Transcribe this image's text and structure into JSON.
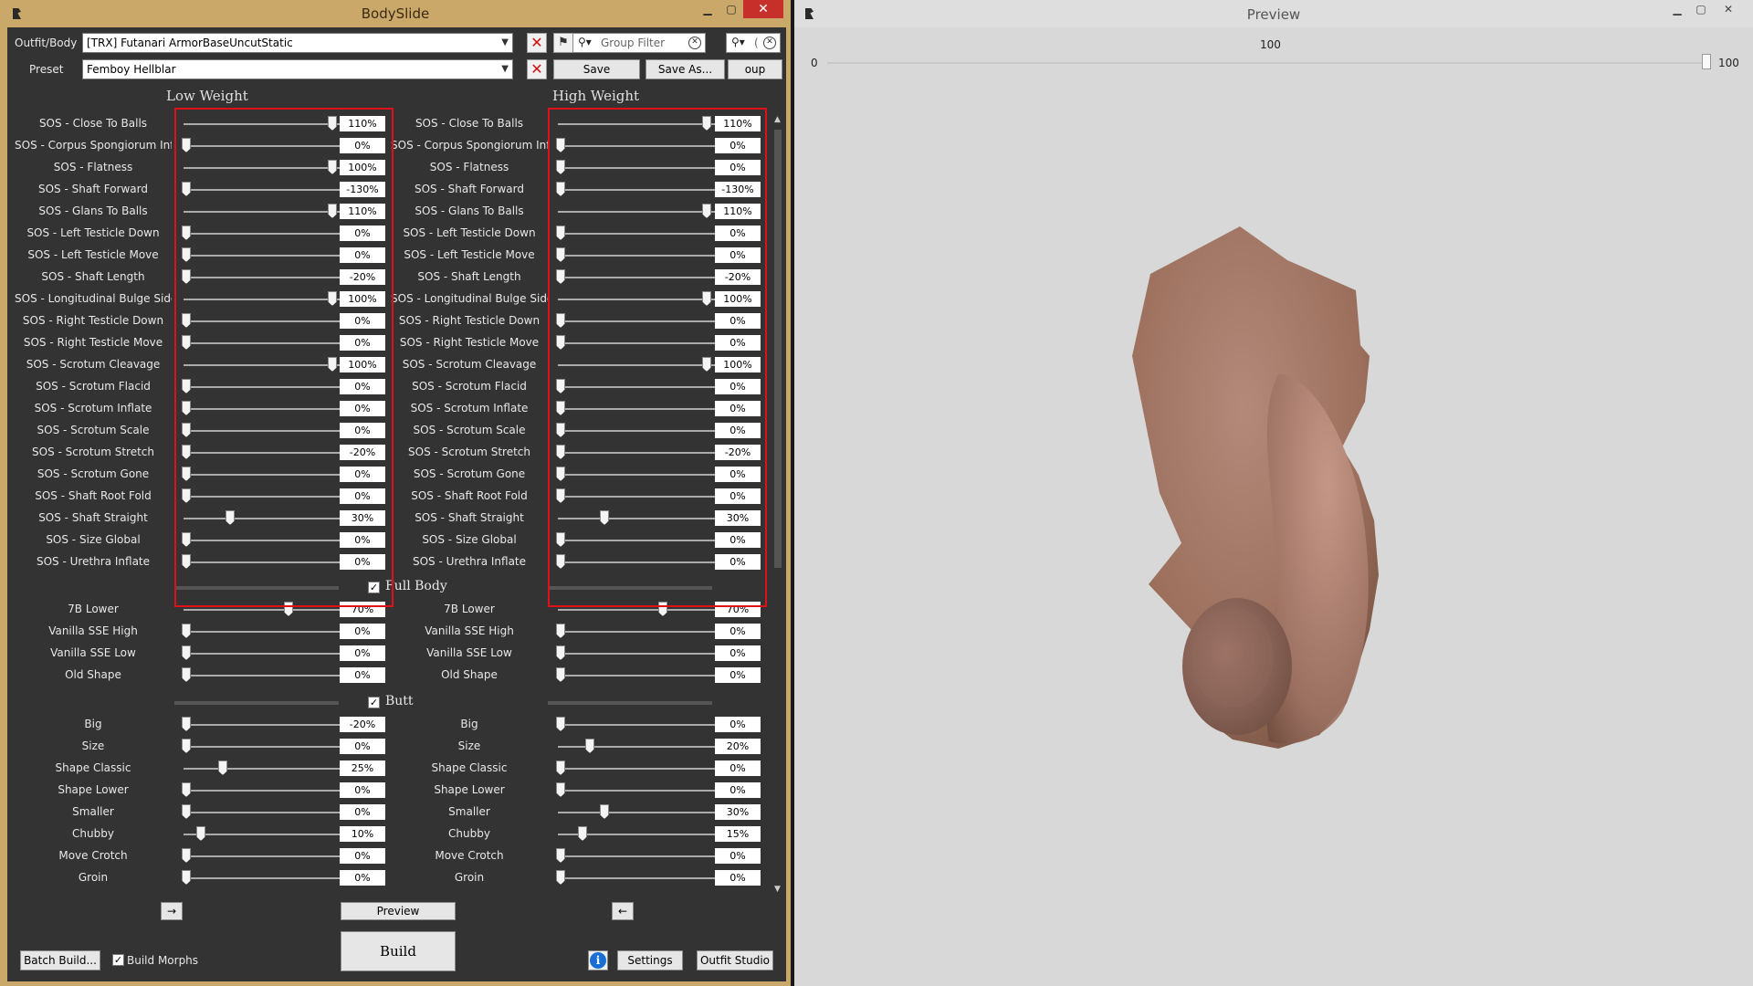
{
  "bodyslide": {
    "title": "BodySlide",
    "outfit_label": "Outfit/Body",
    "outfit_value": "[TRX] Futanari ArmorBaseUncutStatic",
    "preset_label": "Preset",
    "preset_value": "Femboy Hellblar",
    "group_filter_placeholder": "Group Filter",
    "outfit_filter_placeholder": "(",
    "save_label": "Save",
    "save_as_label": "Save As...",
    "group_manager_label": "oup Mana",
    "low_weight_label": "Low Weight",
    "high_weight_label": "High Weight",
    "sos_rows": [
      {
        "name": "SOS - Close To Balls",
        "low": "110%",
        "low_pos": 1.0,
        "high": "110%",
        "high_pos": 1.0
      },
      {
        "name": "SOS - Corpus Spongiorum Inflate",
        "low": "0%",
        "low_pos": 0,
        "high": "0%",
        "high_pos": 0
      },
      {
        "name": "SOS - Flatness",
        "low": "100%",
        "low_pos": 1.0,
        "high": "0%",
        "high_pos": 0
      },
      {
        "name": "SOS - Shaft Forward",
        "low": "-130%",
        "low_pos": 0,
        "high": "-130%",
        "high_pos": 0
      },
      {
        "name": "SOS - Glans To Balls",
        "low": "110%",
        "low_pos": 1.0,
        "high": "110%",
        "high_pos": 1.0
      },
      {
        "name": "SOS - Left Testicle Down",
        "low": "0%",
        "low_pos": 0,
        "high": "0%",
        "high_pos": 0
      },
      {
        "name": "SOS - Left Testicle Move",
        "low": "0%",
        "low_pos": 0,
        "high": "0%",
        "high_pos": 0
      },
      {
        "name": "SOS - Shaft Length",
        "low": "-20%",
        "low_pos": 0,
        "high": "-20%",
        "high_pos": 0
      },
      {
        "name": "SOS - Longitudinal Bulge Side",
        "low": "100%",
        "low_pos": 1.0,
        "high": "100%",
        "high_pos": 1.0
      },
      {
        "name": "SOS - Right Testicle Down",
        "low": "0%",
        "low_pos": 0,
        "high": "0%",
        "high_pos": 0
      },
      {
        "name": "SOS - Right Testicle Move",
        "low": "0%",
        "low_pos": 0,
        "high": "0%",
        "high_pos": 0
      },
      {
        "name": "SOS - Scrotum Cleavage",
        "low": "100%",
        "low_pos": 1.0,
        "high": "100%",
        "high_pos": 1.0
      },
      {
        "name": "SOS - Scrotum Flacid",
        "low": "0%",
        "low_pos": 0,
        "high": "0%",
        "high_pos": 0
      },
      {
        "name": "SOS - Scrotum Inflate",
        "low": "0%",
        "low_pos": 0,
        "high": "0%",
        "high_pos": 0
      },
      {
        "name": "SOS - Scrotum Scale",
        "low": "0%",
        "low_pos": 0,
        "high": "0%",
        "high_pos": 0
      },
      {
        "name": "SOS - Scrotum Stretch",
        "low": "-20%",
        "low_pos": 0,
        "high": "-20%",
        "high_pos": 0
      },
      {
        "name": "SOS - Scrotum Gone",
        "low": "0%",
        "low_pos": 0,
        "high": "0%",
        "high_pos": 0
      },
      {
        "name": "SOS - Shaft Root Fold",
        "low": "0%",
        "low_pos": 0,
        "high": "0%",
        "high_pos": 0
      },
      {
        "name": "SOS - Shaft Straight",
        "low": "30%",
        "low_pos": 0.3,
        "high": "30%",
        "high_pos": 0.3
      },
      {
        "name": "SOS - Size Global",
        "low": "0%",
        "low_pos": 0,
        "high": "0%",
        "high_pos": 0
      },
      {
        "name": "SOS - Urethra Inflate",
        "low": "0%",
        "low_pos": 0,
        "high": "0%",
        "high_pos": 0
      }
    ],
    "full_body_label": "Full Body",
    "full_body_rows": [
      {
        "name": "7B Lower",
        "low": "70%",
        "low_pos": 0.7,
        "high": "70%",
        "high_pos": 0.7
      },
      {
        "name": "Vanilla SSE High",
        "low": "0%",
        "low_pos": 0,
        "high": "0%",
        "high_pos": 0
      },
      {
        "name": "Vanilla SSE Low",
        "low": "0%",
        "low_pos": 0,
        "high": "0%",
        "high_pos": 0
      },
      {
        "name": "Old Shape",
        "low": "0%",
        "low_pos": 0,
        "high": "0%",
        "high_pos": 0
      }
    ],
    "butt_label": "Butt",
    "butt_rows": [
      {
        "name": "Big",
        "low": "-20%",
        "low_pos": 0,
        "high": "0%",
        "high_pos": 0
      },
      {
        "name": "Size",
        "low": "0%",
        "low_pos": 0,
        "high": "20%",
        "high_pos": 0.2
      },
      {
        "name": "Shape Classic",
        "low": "25%",
        "low_pos": 0.25,
        "high": "0%",
        "high_pos": 0
      },
      {
        "name": "Shape Lower",
        "low": "0%",
        "low_pos": 0,
        "high": "0%",
        "high_pos": 0
      },
      {
        "name": "Smaller",
        "low": "0%",
        "low_pos": 0,
        "high": "30%",
        "high_pos": 0.3
      },
      {
        "name": "Chubby",
        "low": "10%",
        "low_pos": 0.1,
        "high": "15%",
        "high_pos": 0.15
      },
      {
        "name": "Move Crotch",
        "low": "0%",
        "low_pos": 0,
        "high": "0%",
        "high_pos": 0
      },
      {
        "name": "Groin",
        "low": "0%",
        "low_pos": 0,
        "high": "0%",
        "high_pos": 0
      }
    ],
    "arrow_right_label": "→",
    "arrow_left_label": "←",
    "preview_label": "Preview",
    "build_label": "Build",
    "batch_build_label": "Batch Build...",
    "build_morphs_label": "Build Morphs",
    "settings_label": "Settings",
    "outfit_studio_label": "Outfit Studio"
  },
  "preview": {
    "title": "Preview",
    "slider_min": "0",
    "slider_max": "100",
    "slider_value": "100",
    "slider_level": 1.0
  },
  "colors": {
    "accent_red": "#e0101a",
    "panel_bg": "#333333",
    "preview_bg": "#dcdcdc",
    "skin": "#a87a65"
  }
}
